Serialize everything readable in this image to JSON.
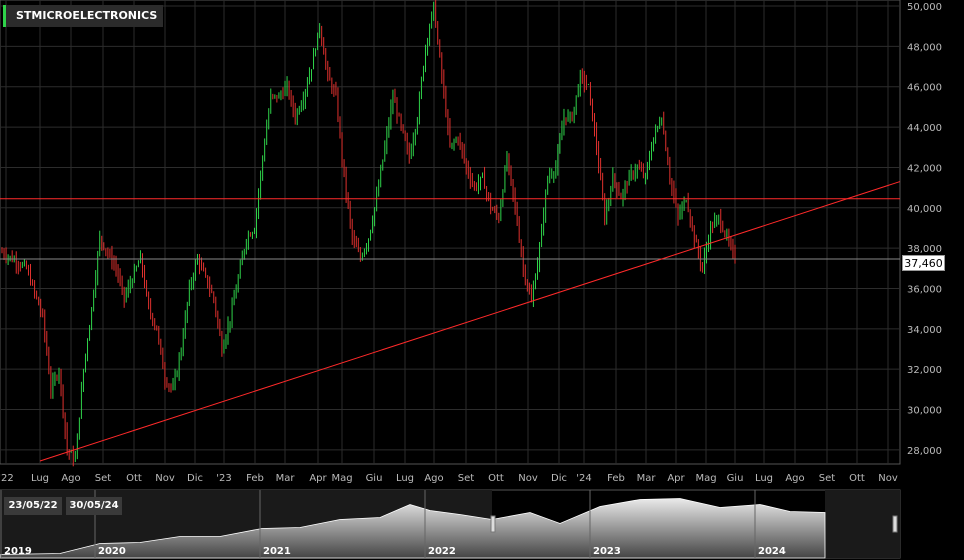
{
  "chart_data": {
    "type": "candlestick",
    "title": "STMICROELECTRONICS",
    "last_price": "37,460",
    "y_ticks": [
      "50,000",
      "48,000",
      "46,000",
      "44,000",
      "42,000",
      "40,000",
      "38,000",
      "36,000",
      "34,000",
      "32,000",
      "30,000",
      "28,000"
    ],
    "ylim": [
      27300,
      50300
    ],
    "x_ticks": [
      "'22",
      "Lug",
      "Ago",
      "Set",
      "Ott",
      "Nov",
      "Dic",
      "'23",
      "Feb",
      "Mar",
      "Apr",
      "Mag",
      "Giu",
      "Lug",
      "Ago",
      "Set",
      "Ott",
      "Nov",
      "Dic",
      "'24",
      "Feb",
      "Mar",
      "Apr",
      "Mag",
      "Giu",
      "Lug",
      "Ago",
      "Set",
      "Ott",
      "Nov"
    ],
    "price_path": [
      [
        0,
        37800
      ],
      [
        3,
        37000
      ],
      [
        5,
        34600
      ],
      [
        6,
        31000
      ],
      [
        7,
        32000
      ],
      [
        8,
        28000
      ],
      [
        9,
        27500
      ],
      [
        10,
        32000
      ],
      [
        11,
        35000
      ],
      [
        12,
        38500
      ],
      [
        14,
        37000
      ],
      [
        15,
        35500
      ],
      [
        17,
        37500
      ],
      [
        18,
        35000
      ],
      [
        19,
        34000
      ],
      [
        20,
        31500
      ],
      [
        21,
        31000
      ],
      [
        22,
        33000
      ],
      [
        23,
        36000
      ],
      [
        24,
        37500
      ],
      [
        25,
        36500
      ],
      [
        26,
        35500
      ],
      [
        27,
        33000
      ],
      [
        28,
        34500
      ],
      [
        29,
        36500
      ],
      [
        30,
        38500
      ],
      [
        31,
        39000
      ],
      [
        32,
        42500
      ],
      [
        33,
        45500
      ],
      [
        34,
        45500
      ],
      [
        35,
        46000
      ],
      [
        36,
        44500
      ],
      [
        37,
        45500
      ],
      [
        38,
        47000
      ],
      [
        39,
        49000
      ],
      [
        40,
        46500
      ],
      [
        41,
        45500
      ],
      [
        42,
        41500
      ],
      [
        43,
        38500
      ],
      [
        44,
        37500
      ],
      [
        45,
        38500
      ],
      [
        46,
        40500
      ],
      [
        47,
        43000
      ],
      [
        48,
        45500
      ],
      [
        49,
        44000
      ],
      [
        50,
        42500
      ],
      [
        51,
        44500
      ],
      [
        52,
        48000
      ],
      [
        53,
        50000
      ],
      [
        54,
        46500
      ],
      [
        55,
        43000
      ],
      [
        56,
        43500
      ],
      [
        57,
        42000
      ],
      [
        58,
        41000
      ],
      [
        59,
        41500
      ],
      [
        60,
        40000
      ],
      [
        61,
        39500
      ],
      [
        62,
        42500
      ],
      [
        63,
        40000
      ],
      [
        64,
        37000
      ],
      [
        65,
        35300
      ],
      [
        66,
        38000
      ],
      [
        67,
        41500
      ],
      [
        68,
        42000
      ],
      [
        69,
        44500
      ],
      [
        70,
        44500
      ],
      [
        71,
        46500
      ],
      [
        72,
        46000
      ],
      [
        73,
        43000
      ],
      [
        74,
        39500
      ],
      [
        75,
        41500
      ],
      [
        76,
        40500
      ],
      [
        77,
        41500
      ],
      [
        78,
        42000
      ],
      [
        79,
        41500
      ],
      [
        80,
        43500
      ],
      [
        81,
        44500
      ],
      [
        82,
        41500
      ],
      [
        83,
        39500
      ],
      [
        84,
        40500
      ],
      [
        85,
        38500
      ],
      [
        86,
        37000
      ],
      [
        87,
        39000
      ],
      [
        88,
        39500
      ],
      [
        89,
        38500
      ],
      [
        90,
        37460
      ]
    ],
    "horizontal_line": 40450,
    "trendline": {
      "x_start": "Lug '22",
      "y_start": 27450,
      "x_end": "Nov '24",
      "y_end": 41300
    },
    "navigator": {
      "range_start": "23/05/22",
      "range_end": "30/05/24",
      "years": [
        "2019",
        "2020",
        "2021",
        "2022",
        "2023",
        "2024"
      ]
    },
    "colors": {
      "up": "#2fd34a",
      "down": "#e0312e",
      "trend": "#ff2a2a",
      "hline": "#ff2a2a",
      "grid": "#2c2c2c"
    }
  }
}
